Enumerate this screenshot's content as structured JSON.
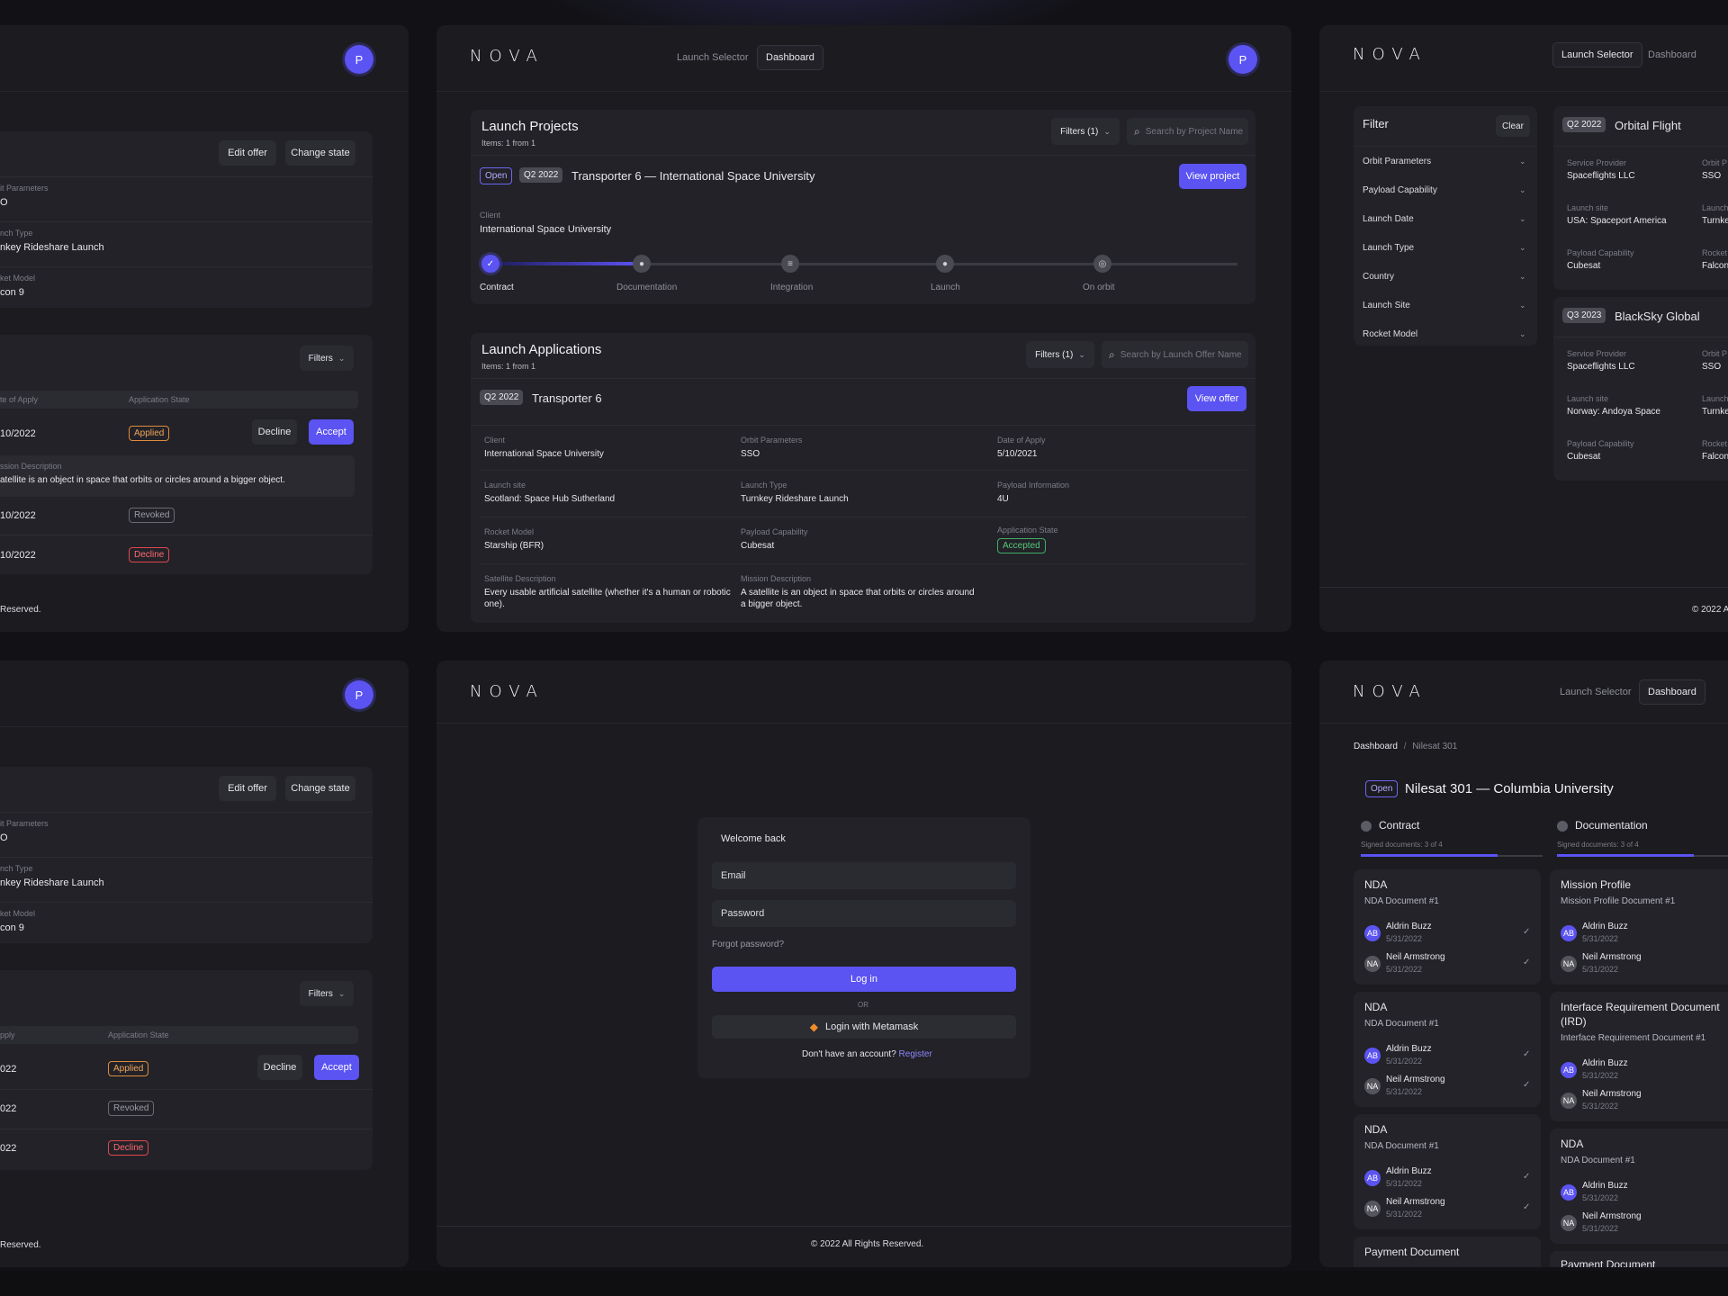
{
  "brand": "NOVA",
  "avatar_letter": "P",
  "nav": {
    "launch_selector": "Launch Selector",
    "dashboard": "Dashboard"
  },
  "footer_rights": "© 2022 All Rights Reserved.",
  "footer_clip_left": "Reserved.",
  "footer_clip_right": "© 2022 A",
  "offer_panel": {
    "edit_offer": "Edit offer",
    "change_state": "Change state",
    "fields": [
      {
        "label": "it Parameters",
        "value": "O"
      },
      {
        "label": "nch Type",
        "value": "nkey Rideshare Launch"
      },
      {
        "label": "ket Model",
        "value": "con 9"
      }
    ],
    "filters": "Filters",
    "col_date": "te of Apply",
    "col_state": "Application State",
    "rows": [
      {
        "date": "10/2022",
        "state": "Applied"
      },
      {
        "date": "10/2022",
        "state": "Revoked"
      },
      {
        "date": "10/2022",
        "state": "Decline"
      }
    ],
    "decline": "Decline",
    "accept": "Accept",
    "mission_label": "ssion Description",
    "mission_text": "atellite is an object in space that orbits or circles around a bigger object."
  },
  "offer_panel_2": {
    "fields": [
      {
        "label": "it Parameters",
        "value": "O"
      },
      {
        "label": "nch Type",
        "value": "nkey Rideshare Launch"
      },
      {
        "label": "ket Model",
        "value": "con 9"
      }
    ],
    "col_date": "pply",
    "col_state": "Application State",
    "rows": [
      {
        "date": "022",
        "state": "Applied"
      },
      {
        "date": "022",
        "state": "Revoked"
      },
      {
        "date": "022",
        "state": "Decline"
      }
    ]
  },
  "dashboard": {
    "projects_title": "Launch Projects",
    "projects_count": "Items: 1 from 1",
    "filters1": "Filters (1)",
    "search_project": "Search by Project Name",
    "project": {
      "status": "Open",
      "quarter": "Q2 2022",
      "name": "Transporter 6  — International Space University",
      "view": "View project",
      "client_label": "Client",
      "client": "International Space University"
    },
    "progress": 0.2,
    "steps": [
      "Contract",
      "Documentation",
      "Integration",
      "Launch",
      "On orbit"
    ],
    "apps_title": "Launch Applications",
    "apps_count": "Items: 1 from 1",
    "search_offer": "Search by Launch Offer Name",
    "app": {
      "quarter": "Q2 2022",
      "name": "Transporter 6",
      "view": "View offer",
      "fields": [
        {
          "label": "Client",
          "value": "International Space University"
        },
        {
          "label": "Orbit Parameters",
          "value": "SSO"
        },
        {
          "label": "Date of Apply",
          "value": "5/10/2021"
        },
        {
          "label": "Launch site",
          "value": "Scotland: Space Hub Sutherland"
        },
        {
          "label": "Launch Type",
          "value": "Turnkey Rideshare Launch"
        },
        {
          "label": "Payload Information",
          "value": "4U"
        },
        {
          "label": "Rocket Model",
          "value": "Starship (BFR)"
        },
        {
          "label": "Payload Capability",
          "value": "Cubesat"
        },
        {
          "label": "Application State",
          "value": "Accepted"
        }
      ],
      "sat_label": "Satellite Description",
      "sat_text_1": "Every usable artificial satellite (whether it's a human or robotic",
      "sat_text_2": "one).",
      "mis_label": "Mission Description",
      "mis_text_1": "A satellite is an object in space that orbits or circles around",
      "mis_text_2": "a bigger object."
    }
  },
  "selector": {
    "filter_title": "Filter",
    "clear": "Clear",
    "filters": [
      "Orbit Parameters",
      "Payload Capability",
      "Launch Date",
      "Launch Type",
      "Country",
      "Launch Site",
      "Rocket Model"
    ],
    "offers": [
      {
        "quarter": "Q2 2022",
        "name": "Orbital Flight",
        "f": [
          {
            "label": "Service Provider",
            "value": "Spaceflights LLC"
          },
          {
            "label": "Orbit P",
            "value": "SSO"
          },
          {
            "label": "Launch site",
            "value": "USA: Spaceport America"
          },
          {
            "label": "Launch",
            "value": "Turnke"
          },
          {
            "label": "Payload Capability",
            "value": "Cubesat"
          },
          {
            "label": "Rocket",
            "value": "Falcon"
          }
        ]
      },
      {
        "quarter": "Q3 2023",
        "name": "BlackSky Global",
        "f": [
          {
            "label": "Service Provider",
            "value": "Spaceflights LLC"
          },
          {
            "label": "Orbit P",
            "value": "SSO"
          },
          {
            "label": "Launch site",
            "value": "Norway: Andoya Space"
          },
          {
            "label": "Launch",
            "value": "Turnke"
          },
          {
            "label": "Payload Capability",
            "value": "Cubesat"
          },
          {
            "label": "Rocket",
            "value": "Falcon"
          }
        ]
      }
    ]
  },
  "login": {
    "welcome": "Welcome back",
    "email": "Email",
    "password": "Password",
    "forgot": "Forgot password?",
    "login": "Log in",
    "or": "OR",
    "metamask": "Login with Metamask",
    "no_account": "Don't have an account?",
    "register": "Register"
  },
  "project_detail": {
    "crumb_home": "Dashboard",
    "crumb_sep": "/",
    "crumb_current": "Nilesat 301",
    "status": "Open",
    "title": "Nilesat 301 — Columbia University",
    "col1": {
      "name": "Contract",
      "signed": "Signed documents: 3 of 4",
      "progress": 0.75
    },
    "col2": {
      "name": "Documentation",
      "signed": "Signed documents: 3 of 4",
      "progress": 0.75
    },
    "col1_docs": [
      {
        "title": "NDA",
        "sub": "NDA Document #1"
      },
      {
        "title": "NDA",
        "sub": "NDA Document #1"
      },
      {
        "title": "NDA",
        "sub": "NDA Document #1"
      }
    ],
    "col1_last": "Payment Document",
    "col2_docs": [
      {
        "title": "Mission Profile",
        "sub": "Mission Profile Document #1"
      },
      {
        "title": "Interface Requirement  Document",
        "title2": "(IRD)",
        "sub": "Interface Requirement Document #1"
      },
      {
        "title": "NDA",
        "sub": "NDA Document #1"
      }
    ],
    "col2_last": "Payment Document",
    "signer1": {
      "initials": "AB",
      "name": "Aldrin Buzz",
      "date": "5/31/2022"
    },
    "signer2": {
      "initials": "NA",
      "name": "Neil Armstrong",
      "date": "5/31/2022"
    }
  }
}
